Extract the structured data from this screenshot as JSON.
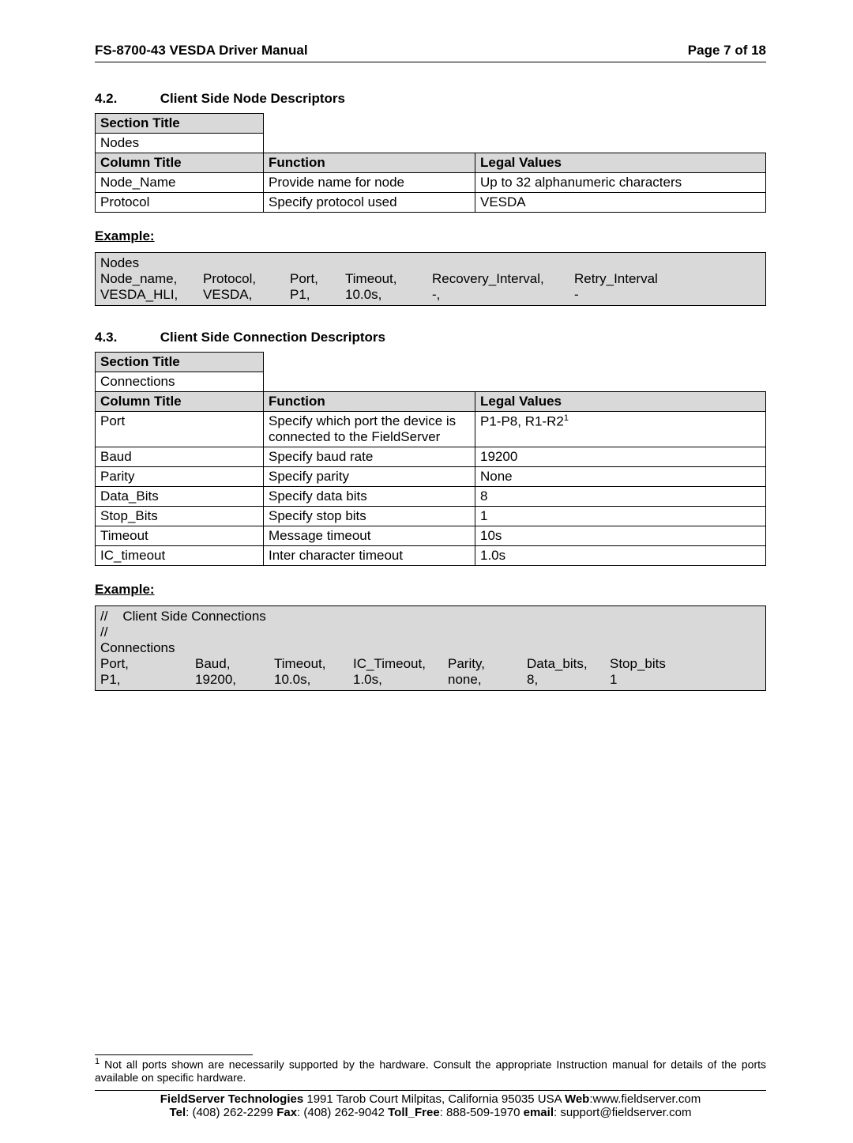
{
  "header": {
    "left": "FS-8700-43 VESDA Driver Manual",
    "right": "Page 7 of 18"
  },
  "s42": {
    "num": "4.2.",
    "title": "Client Side Node Descriptors",
    "sectionTitleHdr": "Section Title",
    "sectionTitleVal": "Nodes",
    "colHdr": "Column Title",
    "funcHdr": "Function",
    "legalHdr": "Legal Values",
    "rows": [
      {
        "c": "Node_Name",
        "f": "Provide name for node",
        "l": "Up to 32 alphanumeric characters"
      },
      {
        "c": "Protocol",
        "f": "Specify protocol used",
        "l": "VESDA"
      }
    ],
    "exampleLabel": "Example:",
    "example": {
      "line1": "Nodes",
      "cols": [
        "Node_name,\nVESDA_HLI,",
        "Protocol,\nVESDA,",
        "Port,\nP1,",
        "Timeout,\n10.0s,",
        "Recovery_Interval,\n-,",
        "Retry_Interval\n-"
      ],
      "widths": [
        130,
        110,
        70,
        110,
        180,
        120
      ]
    }
  },
  "s43": {
    "num": "4.3.",
    "title": "Client Side Connection Descriptors",
    "sectionTitleHdr": "Section Title",
    "sectionTitleVal": "Connections",
    "colHdr": "Column Title",
    "funcHdr": "Function",
    "legalHdr": "Legal Values",
    "rows": [
      {
        "c": "Port",
        "f": "Specify which port the device is connected to the FieldServer",
        "l": "P1-P8, R1-R2",
        "sup": "1"
      },
      {
        "c": "Baud",
        "f": "Specify baud rate",
        "l": "19200"
      },
      {
        "c": "Parity",
        "f": "Specify parity",
        "l": "None"
      },
      {
        "c": "Data_Bits",
        "f": "Specify data bits",
        "l": "8"
      },
      {
        "c": "Stop_Bits",
        "f": "Specify stop bits",
        "l": "1"
      },
      {
        "c": "Timeout",
        "f": "Message timeout",
        "l": "10s"
      },
      {
        "c": "IC_timeout",
        "f": "Inter character timeout",
        "l": "1.0s"
      }
    ],
    "exampleLabel": "Example:",
    "example": {
      "pre": "//    Client Side Connections\n//\nConnections",
      "cols": [
        "Port,\nP1,",
        "Baud,\n19200,",
        "Timeout,\n10.0s,",
        "IC_Timeout,\n1.0s,",
        "Parity,\nnone,",
        "Data_bits,\n8,",
        "Stop_bits\n1"
      ],
      "widths": [
        120,
        100,
        100,
        120,
        100,
        105,
        90
      ]
    }
  },
  "footnote": {
    "sup": "1",
    "text": " Not all ports shown are necessarily supported by the hardware. Consult the appropriate Instruction manual for details of the ports available on specific hardware."
  },
  "footer": {
    "l1a": "FieldServer Technologies",
    "l1b": " 1991 Tarob Court Milpitas, California 95035 USA  ",
    "l1c": "Web",
    "l1d": ":www.fieldserver.com",
    "l2a": "Tel",
    "l2b": ": (408) 262-2299   ",
    "l2c": "Fax",
    "l2d": ": (408) 262-9042   ",
    "l2e": "Toll_Free",
    "l2f": ": 888-509-1970   ",
    "l2g": "email",
    "l2h": ": support@fieldserver.com"
  }
}
